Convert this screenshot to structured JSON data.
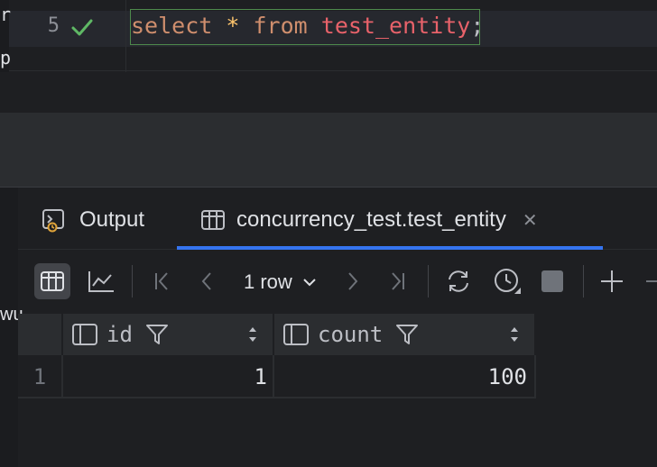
{
  "left_strip": {
    "fragment_1": "r",
    "fragment_2": "p"
  },
  "editor": {
    "line_number": "5",
    "status_icon": "check-icon",
    "sql": {
      "keyword_select": "select",
      "star": "*",
      "keyword_from": "from",
      "table": "test_entity",
      "semicolon": ";"
    }
  },
  "services": {
    "left_fragment": "wu",
    "tabs": [
      {
        "label": "Output",
        "icon": "console-icon"
      },
      {
        "label": "concurrency_test.test_entity",
        "icon": "table-icon",
        "active": true
      }
    ],
    "close_symbol": "✕",
    "toolbar": {
      "row_count": "1 row"
    },
    "grid": {
      "columns": [
        {
          "name": "id"
        },
        {
          "name": "count"
        }
      ],
      "rows": [
        {
          "row_number": "1",
          "cells": [
            "1",
            "100"
          ]
        }
      ]
    },
    "colors": {
      "accent": "#3574f0",
      "success": "#5fb865",
      "keyword": "#cf8e6d",
      "table": "#e8626a"
    }
  }
}
